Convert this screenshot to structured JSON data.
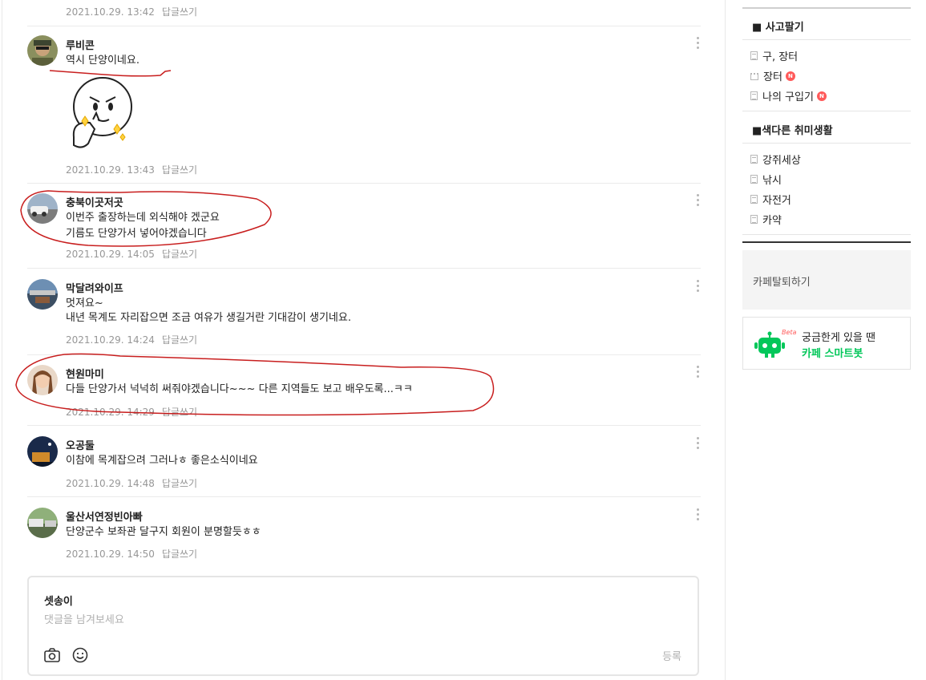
{
  "comments": [
    {
      "date": "2021.10.29. 13:42",
      "reply": "답글쓰기"
    },
    {
      "author": "루비콘",
      "lines": [
        "역시 단양이네요."
      ],
      "date": "2021.10.29. 13:43",
      "reply": "답글쓰기"
    },
    {
      "author": "충북이곳저곳",
      "lines": [
        "이번주 출장하는데 외식해야 겠군요",
        "기름도 단양가서 넣어야겠습니다"
      ],
      "date": "2021.10.29. 14:05",
      "reply": "답글쓰기"
    },
    {
      "author": "막달려와이프",
      "lines": [
        "멋져요~",
        "내년 목계도 자리잡으면 조금 여유가 생길거란 기대감이 생기네요."
      ],
      "date": "2021.10.29. 14:24",
      "reply": "답글쓰기"
    },
    {
      "author": "현원마미",
      "lines": [
        "다들 단양가서 넉넉히 써줘야겠습니다~~~ 다른 지역들도 보고 배우도록...ㅋㅋ"
      ],
      "date": "2021.10.29. 14:29",
      "reply": "답글쓰기"
    },
    {
      "author": "오공둘",
      "lines": [
        "이참에 목계잡으려 그러나ㅎ 좋은소식이네요"
      ],
      "date": "2021.10.29. 14:48",
      "reply": "답글쓰기"
    },
    {
      "author": "울산서연정빈아빠",
      "lines": [
        "단양군수 보좌관 달구지 회원이 분명할듯ㅎㅎ"
      ],
      "date": "2021.10.29. 14:50",
      "reply": "답글쓰기"
    }
  ],
  "write_box": {
    "author": "셋송이",
    "placeholder": "댓글을 남겨보세요",
    "submit_label": "등록",
    "camera_icon": "camera-icon",
    "emoji_icon": "smiley-icon"
  },
  "sidebar": {
    "section1": {
      "title": "■ 사고팔기",
      "items": [
        {
          "label": "구, 장터",
          "icon": "doc-icon",
          "badge": ""
        },
        {
          "label": "장터",
          "icon": "market-icon",
          "badge": "N"
        },
        {
          "label": "나의 구입기",
          "icon": "doc-icon",
          "badge": "N"
        }
      ]
    },
    "section2": {
      "title": "■색다른 취미생활",
      "items": [
        {
          "label": "강쥐세상",
          "icon": "doc-icon"
        },
        {
          "label": "낚시",
          "icon": "doc-icon"
        },
        {
          "label": "자전거",
          "icon": "doc-icon"
        },
        {
          "label": "카약",
          "icon": "doc-icon"
        }
      ]
    },
    "leave_cafe": "카페탈퇴하기",
    "smartbot": {
      "line1": "궁금한게 있을 땐",
      "line2": "카페 스마트봇",
      "beta": "Beta"
    }
  },
  "colors": {
    "accent_green": "#03c75a",
    "badge_red": "#ff5959",
    "annotation_red": "#c81e1e"
  }
}
